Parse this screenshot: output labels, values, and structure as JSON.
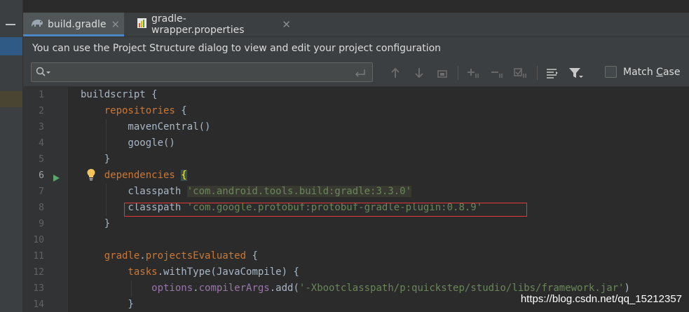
{
  "tabs": [
    {
      "label": "build.gradle",
      "active": true,
      "icon": "gradle-elephant-icon"
    },
    {
      "label": "gradle-wrapper.properties",
      "active": false,
      "icon": "properties-chart-icon"
    }
  ],
  "banner": {
    "text": "You can use the Project Structure dialog to view and edit your project configuration"
  },
  "find": {
    "query": "",
    "match_case_label_pre": "Match ",
    "match_case_label_u": "C",
    "match_case_label_post": "ase",
    "match_case_checked": false
  },
  "editor": {
    "line_numbers": [
      "1",
      "2",
      "3",
      "4",
      "5",
      "6",
      "7",
      "8",
      "9",
      "10",
      "11",
      "12",
      "13",
      "14"
    ],
    "lines": {
      "l1_a": "buildscript",
      "l1_b": " {",
      "l2_a": "    repositories",
      "l2_b": " {",
      "l3": "        mavenCentral()",
      "l4": "        google()",
      "l5": "    }",
      "l6_a": "    dependencies ",
      "l6_b": "{",
      "l7_a": "        classpath ",
      "l7_b": "'com.android.tools.build:gradle:3.3.0'",
      "l8_a": "        classpath ",
      "l8_b": "'com.google.protobuf:protobuf-gradle-plugin:0.8.9'",
      "l9": "    }",
      "l10": "",
      "l11_a": "    gradle",
      "l11_b": ".",
      "l11_c": "projectsEvaluated",
      "l11_d": " {",
      "l12_a": "        tasks",
      "l12_b": ".withType(JavaCompile) {",
      "l13_a": "            options",
      "l13_b": ".",
      "l13_c": "compilerArgs",
      "l13_d": ".add(",
      "l13_e": "'-Xbootclasspath/p:quickstep/studio/libs/framework.jar'",
      "l13_f": ")",
      "l14": "        }"
    }
  },
  "watermark": "https://blog.csdn.net/qq_15212357",
  "colors": {
    "keyword": "#cc7832",
    "string": "#6a8759",
    "property": "#9876aa",
    "highlight_box": "#e0393a"
  }
}
